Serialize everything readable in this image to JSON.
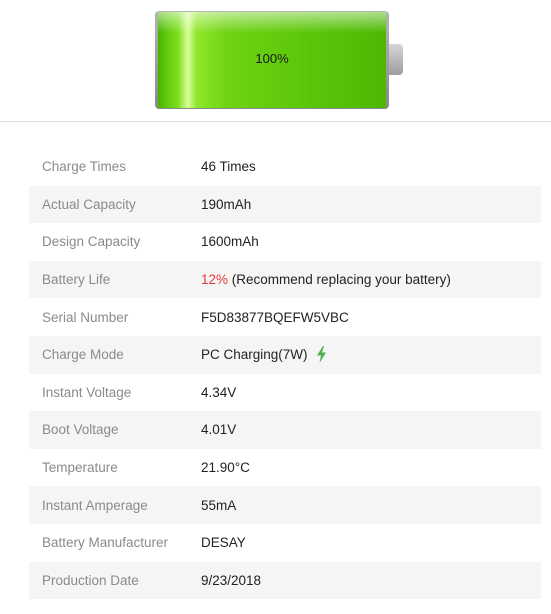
{
  "battery": {
    "level_percent": 100,
    "level_text": "100%",
    "fill_color": "#5ec80a"
  },
  "rows": [
    {
      "label": "Charge Times",
      "value": "46 Times"
    },
    {
      "label": "Actual Capacity",
      "value": "190mAh"
    },
    {
      "label": "Design Capacity",
      "value": "1600mAh"
    },
    {
      "label": "Battery Life",
      "value_highlight": "12%",
      "value_rest": " (Recommend replacing your battery)",
      "highlight_color": "#e5383b"
    },
    {
      "label": "Serial Number",
      "value": "F5D83877BQEFW5VBC"
    },
    {
      "label": "Charge Mode",
      "value": "PC Charging(7W)",
      "icon": "lightning-bolt-icon",
      "icon_color": "#4caf50"
    },
    {
      "label": "Instant Voltage",
      "value": "4.34V"
    },
    {
      "label": "Boot Voltage",
      "value": "4.01V"
    },
    {
      "label": "Temperature",
      "value": "21.90°C"
    },
    {
      "label": "Instant Amperage",
      "value": "55mA"
    },
    {
      "label": "Battery Manufacturer",
      "value": "DESAY"
    },
    {
      "label": "Production Date",
      "value": "9/23/2018"
    }
  ]
}
